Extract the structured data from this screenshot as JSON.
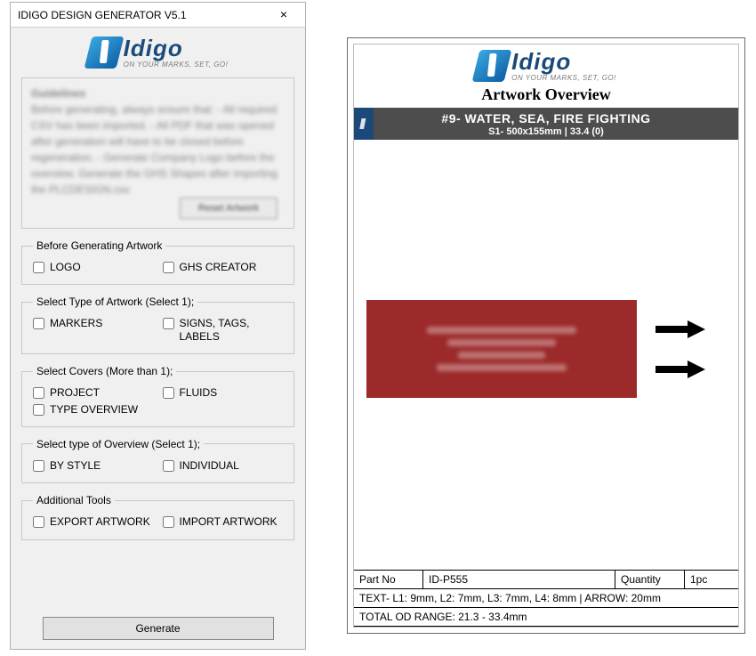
{
  "dialog": {
    "title": "IDIGO DESIGN GENERATOR V5.1",
    "close": "×",
    "logo_brand": "Idigo",
    "logo_tag": "ON YOUR MARKS, SET, GO!",
    "guidelines": {
      "heading": "Guidelines",
      "body": "Before generating, always ensure that:\n- All required CSV has been imported.\n- All PDF that was opened after generation will have to be closed before regeneration.\n- Generate Company Logo before the overview. Generate the GHS Shapes after importing the PLCDESIGN.csv",
      "button": "Reset Artwork"
    },
    "groups": {
      "before": {
        "legend": "Before Generating Artwork",
        "logo": "LOGO",
        "ghs": "GHS CREATOR"
      },
      "type": {
        "legend": "Select Type of Artwork (Select 1);",
        "markers": "MARKERS",
        "signs": "SIGNS, TAGS, LABELS"
      },
      "covers": {
        "legend": "Select Covers (More than 1);",
        "project": "PROJECT",
        "fluids": "FLUIDS",
        "typeov": "TYPE OVERVIEW"
      },
      "overview": {
        "legend": "Select type of Overview (Select 1);",
        "bystyle": "BY STYLE",
        "individual": "INDIVIDUAL"
      },
      "tools": {
        "legend": "Additional Tools",
        "export": "EXPORT ARTWORK",
        "import": "IMPORT ARTWORK"
      }
    },
    "generate": "Generate"
  },
  "doc": {
    "logo_brand": "Idigo",
    "logo_tag": "ON YOUR MARKS, SET, GO!",
    "title": "Artwork Overview",
    "banner": {
      "line1": "#9- WATER, SEA, FIRE FIGHTING",
      "line2": "S1- 500x155mm | 33.4 (0)"
    },
    "spec": {
      "partno_label": "Part No",
      "partno_value": "ID-P555",
      "qty_label": "Quantity",
      "qty_value": "1pc",
      "text_line": "TEXT- L1:  9mm, L2:  7mm, L3:  7mm, L4:  8mm | ARROW:  20mm",
      "od_line": "TOTAL OD RANGE: 21.3 - 33.4mm"
    }
  }
}
